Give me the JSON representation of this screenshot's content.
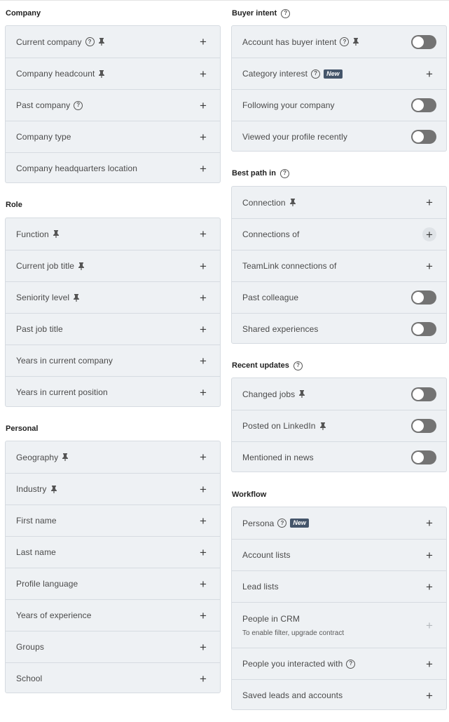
{
  "left": {
    "company": {
      "title": "Company",
      "items": [
        {
          "label": "Current company",
          "help": true,
          "pin": true
        },
        {
          "label": "Company headcount",
          "pin": true
        },
        {
          "label": "Past company",
          "help": true
        },
        {
          "label": "Company type"
        },
        {
          "label": "Company headquarters location"
        }
      ]
    },
    "role": {
      "title": "Role",
      "items": [
        {
          "label": "Function",
          "pin": true
        },
        {
          "label": "Current job title",
          "pin": true
        },
        {
          "label": "Seniority level",
          "pin": true
        },
        {
          "label": "Past job title"
        },
        {
          "label": "Years in current company"
        },
        {
          "label": "Years in current position"
        }
      ]
    },
    "personal": {
      "title": "Personal",
      "items": [
        {
          "label": "Geography",
          "pin": true
        },
        {
          "label": "Industry",
          "pin": true
        },
        {
          "label": "First name"
        },
        {
          "label": "Last name"
        },
        {
          "label": "Profile language"
        },
        {
          "label": "Years of experience"
        },
        {
          "label": "Groups"
        },
        {
          "label": "School"
        }
      ]
    }
  },
  "right": {
    "buyer_intent": {
      "title": "Buyer intent",
      "items": [
        {
          "label": "Account has buyer intent",
          "help": true,
          "pin": true,
          "control": "toggle"
        },
        {
          "label": "Category interest",
          "help": true,
          "badge": "New",
          "control": "plus"
        },
        {
          "label": "Following your company",
          "control": "toggle"
        },
        {
          "label": "Viewed your profile recently",
          "control": "toggle"
        }
      ]
    },
    "best_path": {
      "title": "Best path in",
      "items": [
        {
          "label": "Connection",
          "pin": true,
          "control": "plus"
        },
        {
          "label": "Connections of",
          "control": "plus-hover"
        },
        {
          "label": "TeamLink connections of",
          "control": "plus"
        },
        {
          "label": "Past colleague",
          "control": "toggle"
        },
        {
          "label": "Shared experiences",
          "control": "toggle"
        }
      ]
    },
    "recent_updates": {
      "title": "Recent updates",
      "items": [
        {
          "label": "Changed jobs",
          "pin": true,
          "control": "toggle"
        },
        {
          "label": "Posted on LinkedIn",
          "pin": true,
          "control": "toggle"
        },
        {
          "label": "Mentioned in news",
          "control": "toggle"
        }
      ]
    },
    "workflow": {
      "title": "Workflow",
      "items": [
        {
          "label": "Persona",
          "help": true,
          "badge": "New",
          "control": "plus"
        },
        {
          "label": "Account lists",
          "control": "plus"
        },
        {
          "label": "Lead lists",
          "control": "plus"
        },
        {
          "label": "People in CRM",
          "sub": "To enable filter, upgrade contract",
          "control": "plus-disabled"
        },
        {
          "label": "People you interacted with",
          "help": true,
          "control": "plus"
        },
        {
          "label": "Saved leads and accounts",
          "control": "plus"
        }
      ]
    }
  },
  "icons": {
    "help": "help-circle-icon",
    "pin": "pin-icon",
    "plus": "plus-icon"
  },
  "colors": {
    "panel_bg": "#eef1f4",
    "border": "#d6dbe1",
    "toggle_off": "#737373",
    "badge_bg": "#44556a"
  }
}
